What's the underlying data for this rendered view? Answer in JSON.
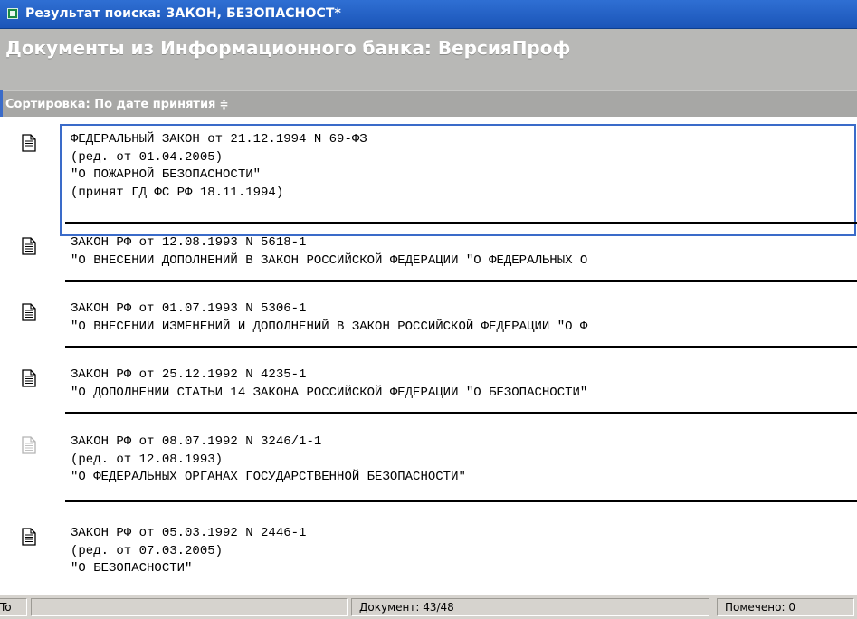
{
  "window": {
    "title": "Результат поиска: ЗАКОН, БЕЗОПАСНОСТ*"
  },
  "header": {
    "heading": "Документы из Информационного банка: ВерсияПроф",
    "sort_label": "Сортировка: По дате принятия",
    "sort_arrow": "≑"
  },
  "documents": [
    {
      "lines": [
        "ФЕДЕРАЛЬНЫЙ ЗАКОН от 21.12.1994 N 69-ФЗ",
        "(ред. от 01.04.2005)",
        "\"О ПОЖАРНОЙ БЕЗОПАСНОСТИ\"",
        "(принят ГД ФС РФ 18.11.1994)"
      ],
      "icon": "document-icon",
      "selected": true
    },
    {
      "lines": [
        "ЗАКОН РФ от 12.08.1993 N 5618-1",
        "\"О ВНЕСЕНИИ ДОПОЛНЕНИЙ В ЗАКОН РОССИЙСКОЙ ФЕДЕРАЦИИ \"О ФЕДЕРАЛЬНЫХ О"
      ],
      "icon": "document-icon"
    },
    {
      "lines": [
        "ЗАКОН РФ от 01.07.1993 N 5306-1",
        "\"О ВНЕСЕНИИ ИЗМЕНЕНИЙ И ДОПОЛНЕНИЙ В ЗАКОН РОССИЙСКОЙ ФЕДЕРАЦИИ \"О Ф"
      ],
      "icon": "document-icon"
    },
    {
      "lines": [
        "ЗАКОН РФ от 25.12.1992 N 4235-1",
        "\"О ДОПОЛНЕНИИ СТАТЬИ 14 ЗАКОНА РОССИЙСКОЙ ФЕДЕРАЦИИ \"О БЕЗОПАСНОСТИ\""
      ],
      "icon": "document-icon"
    },
    {
      "lines": [
        "ЗАКОН РФ от 08.07.1992 N 3246/1-1",
        "(ред. от 12.08.1993)",
        "\"О ФЕДЕРАЛЬНЫХ ОРГАНАХ ГОСУДАРСТВЕННОЙ БЕЗОПАСНОСТИ\""
      ],
      "icon": "document-inactive-icon"
    },
    {
      "lines": [
        "ЗАКОН РФ от 05.03.1992 N 2446-1",
        "(ред. от 07.03.2005)",
        "\"О БЕЗОПАСНОСТИ\""
      ],
      "icon": "document-icon"
    }
  ],
  "status": {
    "left": "To",
    "document": "Документ: 43/48",
    "marked": "Помечено: 0"
  }
}
